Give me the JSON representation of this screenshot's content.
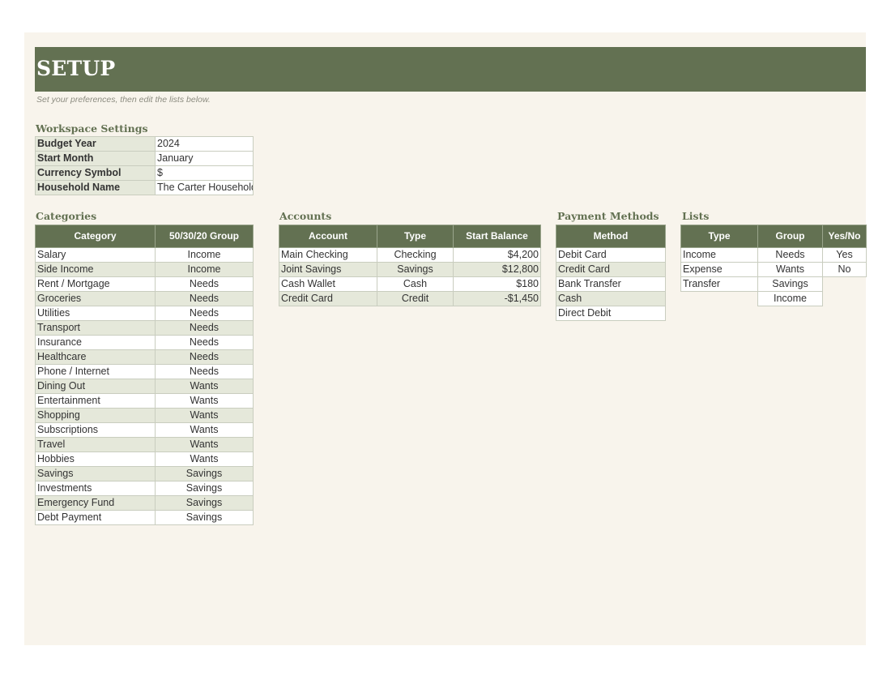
{
  "title": "SETUP",
  "subtitle": "Set your preferences, then edit the lists below.",
  "workspace": {
    "title": "Workspace Settings",
    "rows": [
      {
        "label": "Budget Year",
        "value": "2024"
      },
      {
        "label": "Start Month",
        "value": "January"
      },
      {
        "label": "Currency Symbol",
        "value": "$"
      },
      {
        "label": "Household Name",
        "value": "The Carter Household"
      }
    ]
  },
  "categories": {
    "title": "Categories",
    "headers": [
      "Category",
      "50/30/20 Group"
    ],
    "rows": [
      [
        "Salary",
        "Income"
      ],
      [
        "Side Income",
        "Income"
      ],
      [
        "Rent / Mortgage",
        "Needs"
      ],
      [
        "Groceries",
        "Needs"
      ],
      [
        "Utilities",
        "Needs"
      ],
      [
        "Transport",
        "Needs"
      ],
      [
        "Insurance",
        "Needs"
      ],
      [
        "Healthcare",
        "Needs"
      ],
      [
        "Phone / Internet",
        "Needs"
      ],
      [
        "Dining Out",
        "Wants"
      ],
      [
        "Entertainment",
        "Wants"
      ],
      [
        "Shopping",
        "Wants"
      ],
      [
        "Subscriptions",
        "Wants"
      ],
      [
        "Travel",
        "Wants"
      ],
      [
        "Hobbies",
        "Wants"
      ],
      [
        "Savings",
        "Savings"
      ],
      [
        "Investments",
        "Savings"
      ],
      [
        "Emergency Fund",
        "Savings"
      ],
      [
        "Debt Payment",
        "Savings"
      ]
    ]
  },
  "accounts": {
    "title": "Accounts",
    "headers": [
      "Account",
      "Type",
      "Start Balance"
    ],
    "rows": [
      [
        "Main Checking",
        "Checking",
        "$4,200"
      ],
      [
        "Joint Savings",
        "Savings",
        "$12,800"
      ],
      [
        "Cash Wallet",
        "Cash",
        "$180"
      ],
      [
        "Credit Card",
        "Credit",
        "-$1,450"
      ]
    ]
  },
  "payment_methods": {
    "title": "Payment Methods",
    "headers": [
      "Method"
    ],
    "rows": [
      "Debit Card",
      "Credit Card",
      "Bank Transfer",
      "Cash",
      "Direct Debit"
    ]
  },
  "lists": {
    "title": "Lists",
    "headers": [
      "Type",
      "Group",
      "Yes/No"
    ],
    "types": [
      "Income",
      "Expense",
      "Transfer"
    ],
    "groups": [
      "Needs",
      "Wants",
      "Savings",
      "Income"
    ],
    "yes_no": [
      "Yes",
      "No"
    ]
  },
  "colors": {
    "header_green": "#637152",
    "band_green": "#e5e8da",
    "page_background": "#f8f4ec"
  }
}
